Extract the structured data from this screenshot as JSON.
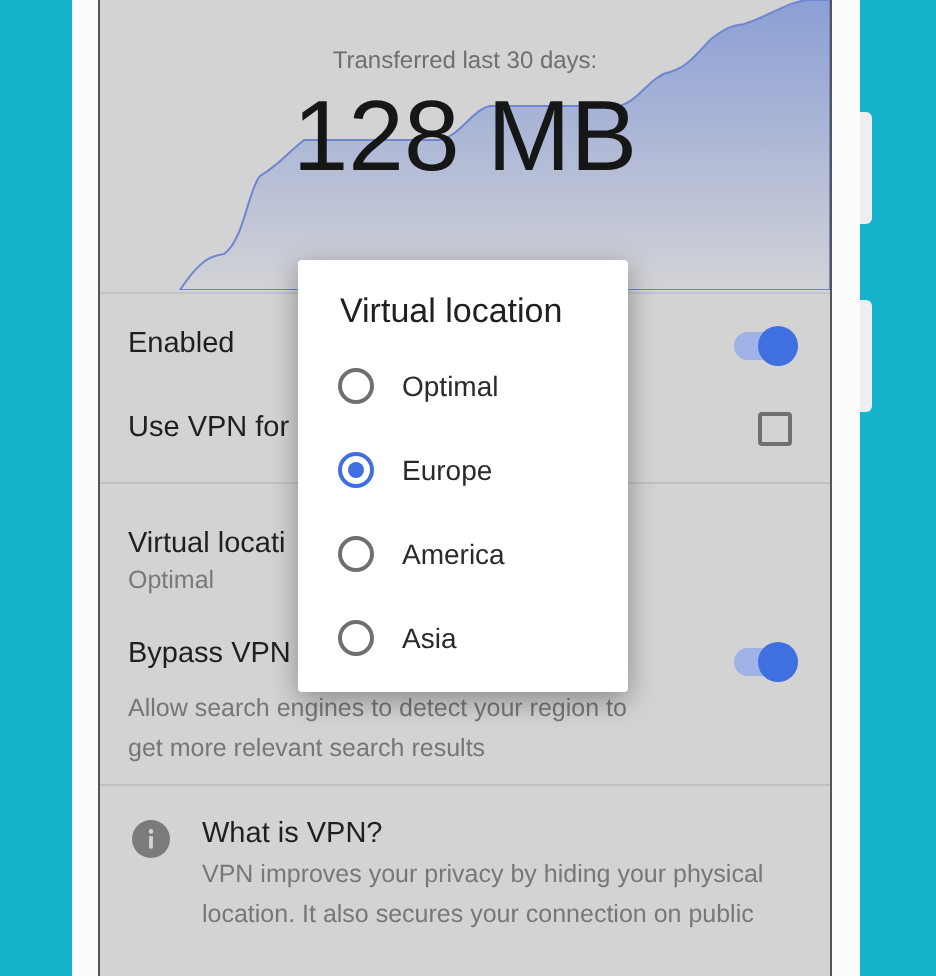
{
  "header": {
    "caption": "Transferred last 30 days:",
    "amount": "128 MB"
  },
  "sections": [
    {
      "items": [
        {
          "kind": "toggle",
          "label": "Enabled",
          "on": true
        },
        {
          "kind": "checkbox",
          "label": "Use VPN for",
          "checked": false
        }
      ]
    },
    {
      "items": [
        {
          "kind": "value",
          "label": "Virtual locati",
          "value": "Optimal"
        },
        {
          "kind": "toggle",
          "label": "Bypass VPN",
          "description": "Allow search engines to detect your region to get more relevant search results",
          "on": true
        }
      ]
    }
  ],
  "info": {
    "title": "What is VPN?",
    "text": "VPN improves your privacy by hiding your physical location. It also secures your connection on public"
  },
  "dialog": {
    "title": "Virtual location",
    "options": [
      {
        "label": "Optimal",
        "selected": false
      },
      {
        "label": "Europe",
        "selected": true
      },
      {
        "label": "America",
        "selected": false
      },
      {
        "label": "Asia",
        "selected": false
      }
    ]
  }
}
